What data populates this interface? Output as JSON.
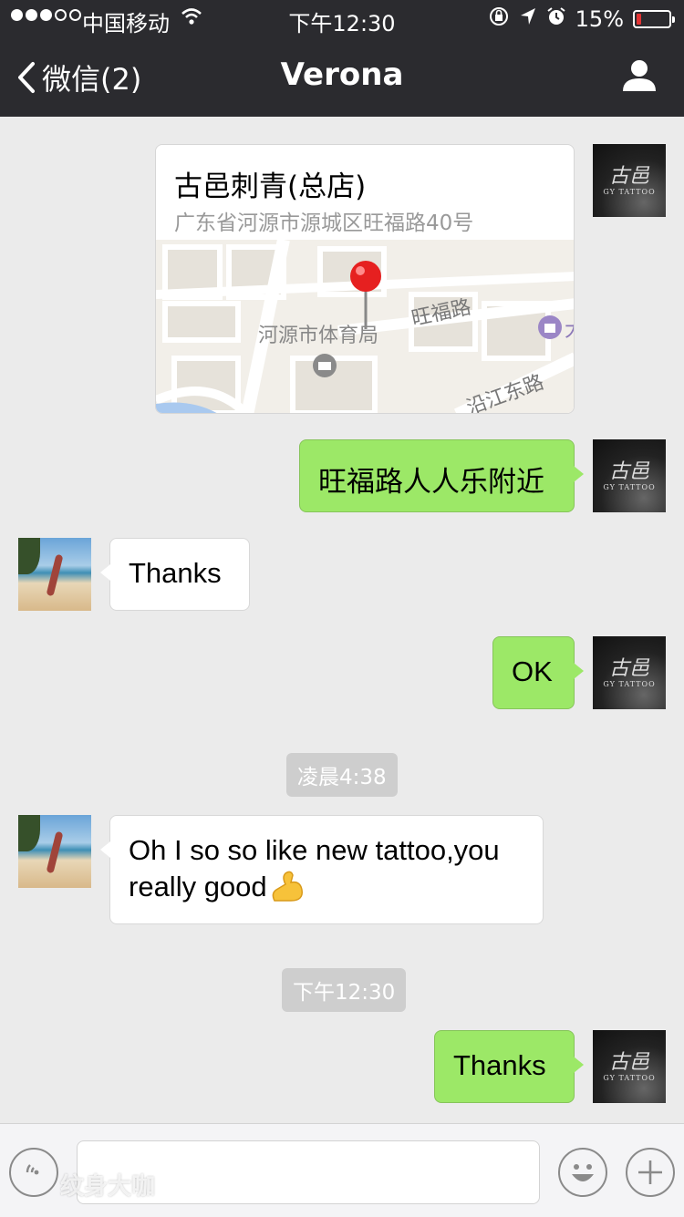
{
  "status_bar": {
    "carrier": "中国移动",
    "time": "下午12:30",
    "battery_percent": "15%",
    "battery_level": 0.15
  },
  "nav": {
    "back_label": "微信(2)",
    "title": "Verona"
  },
  "location": {
    "name": "古邑刺青(总店)",
    "address": "广东省河源市源城区旺福路40号",
    "map_labels": {
      "road_1": "旺福路",
      "road_2": "沿江东路",
      "poi": "河源市体育局",
      "edge": "大"
    }
  },
  "messages": {
    "m1": "旺福路人人乐附近",
    "m2": "Thanks",
    "m3": "OK",
    "m4_line1": "Oh I so so like new tattoo,you",
    "m4_line2": "really good",
    "m5": "Thanks"
  },
  "timestamps": {
    "t1": "凌晨4:38",
    "t2": "下午12:30"
  },
  "avatar": {
    "tattoo_glyph": "古邑",
    "tattoo_brand": "GY TATTOO"
  },
  "watermark": "纹身大咖",
  "colors": {
    "nav_bg": "#2b2b2f",
    "chat_bg": "#ebebeb",
    "sent_bubble": "#9ce867",
    "received_bubble": "#ffffff",
    "battery_low": "#e33333",
    "map_pin": "#e62020"
  }
}
